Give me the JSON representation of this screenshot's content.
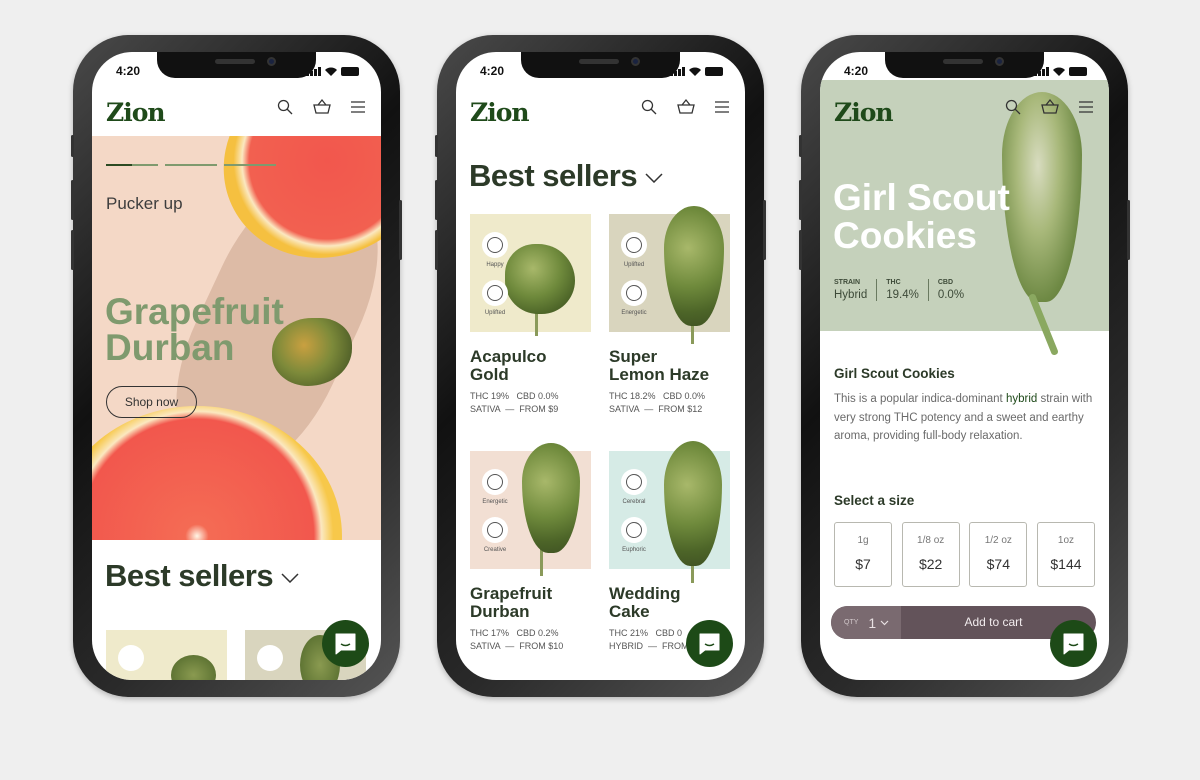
{
  "status": {
    "time": "4:20"
  },
  "brand": {
    "logo": "Zion",
    "color": "#1f4a1a",
    "chat_color": "#1d4a17"
  },
  "header_icons": [
    "search-icon",
    "basket-icon",
    "menu-icon"
  ],
  "home": {
    "eyebrow": "Pucker up",
    "title_line1": "Grapefruit",
    "title_line2": "Durban",
    "cta": "Shop now",
    "carousel": {
      "slides": 3,
      "active": 1
    },
    "section": "Best sellers"
  },
  "list": {
    "section": "Best sellers",
    "products": [
      {
        "name1": "Acapulco",
        "name2": "Gold",
        "thc": "THC 19%",
        "cbd": "CBD 0.0%",
        "type": "SATIVA",
        "price": "FROM $9",
        "effects": [
          "Happy",
          "Uplifted"
        ],
        "bg": "#efeacb"
      },
      {
        "name1": "Super",
        "name2": "Lemon Haze",
        "thc": "THC 18.2%",
        "cbd": "CBD 0.0%",
        "type": "SATIVA",
        "price": "FROM $12",
        "effects": [
          "Uplifted",
          "Energetic"
        ],
        "bg": "#d9d5be"
      },
      {
        "name1": "Grapefruit",
        "name2": "Durban",
        "thc": "THC 17%",
        "cbd": "CBD 0.2%",
        "type": "SATIVA",
        "price": "FROM $10",
        "effects": [
          "Energetic",
          "Creative"
        ],
        "bg": "#f2dfd3"
      },
      {
        "name1": "Wedding",
        "name2": "Cake",
        "thc": "THC 21%",
        "cbd": "CBD 0",
        "type": "HYBRID",
        "price": "FROM",
        "effects": [
          "Cerebral",
          "Euphoric"
        ],
        "bg": "#d6ebe6"
      }
    ]
  },
  "detail": {
    "title_line1": "Girl Scout",
    "title_line2": "Cookies",
    "stats": [
      {
        "label": "STRAIN",
        "value": "Hybrid"
      },
      {
        "label": "THC",
        "value": "19.4%"
      },
      {
        "label": "CBD",
        "value": "0.0%"
      }
    ],
    "name": "Girl Scout Cookies",
    "desc_before": "This is a popular indica-dominant ",
    "desc_link": "hybrid",
    "desc_after": " strain with very strong THC potency and a sweet and earthy aroma, providing full-body relaxation.",
    "size_heading": "Select a size",
    "sizes": [
      {
        "size": "1g",
        "price": "$7"
      },
      {
        "size": "1/8 oz",
        "price": "$22"
      },
      {
        "size": "1/2 oz",
        "price": "$74"
      },
      {
        "size": "1oz",
        "price": "$144"
      }
    ],
    "qty_label": "QTY",
    "qty": "1",
    "add_to_cart": "Add to cart"
  }
}
